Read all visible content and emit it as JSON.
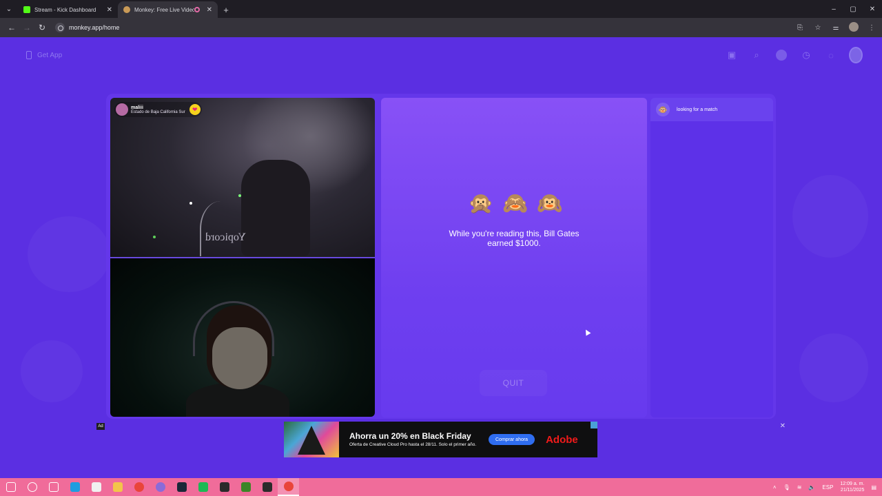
{
  "browser": {
    "tabs": [
      {
        "title": "Stream - Kick Dashboard",
        "favicon_color": "#53fc18",
        "active": false
      },
      {
        "title": "Monkey: Free Live Video Ch",
        "favicon_color": "#c99a57",
        "active": true
      }
    ],
    "new_tab": "+",
    "address": "monkey.app/home",
    "window_controls": {
      "minimize": "–",
      "maximize": "▢",
      "close": "✕"
    }
  },
  "header": {
    "get_app_label": "Get App"
  },
  "remote_video": {
    "user_name": "maliii",
    "user_location": "Estado de Baja California Sur",
    "heart": "❤",
    "mirrored_text": "Yopicord"
  },
  "center": {
    "monkeys": [
      "🙊",
      "🙈",
      "🙉"
    ],
    "message": "While you're reading this, Bill Gates earned $1000.",
    "quit_label": "QUIT"
  },
  "side": {
    "match_icon": "🐵",
    "match_text": "looking for a match"
  },
  "ad": {
    "tag": "Ad",
    "close": "✕",
    "headline": "Ahorra un 20% en Black Friday",
    "subtext": "Oferta de Creative Cloud Pro hasta el 28/11. Solo el primer año.",
    "cta": "Comprar ahora",
    "brand": "Adobe"
  },
  "taskbar": {
    "icons": [
      "windows-start-icon",
      "search-icon",
      "task-view-icon",
      "edge-icon",
      "store-icon",
      "file-explorer-icon",
      "chrome-icon",
      "chrome-profile-icon",
      "steam-icon",
      "spotify-icon",
      "obs-icon",
      "minecraft-icon",
      "epic-games-icon",
      "chrome-active-icon"
    ],
    "colors": [
      "#ffffff",
      "#ffffff",
      "#ffffff",
      "#1f9de0",
      "#f0f0f0",
      "#f3c44a",
      "#e9453a",
      "#8b6bd9",
      "#1b2838",
      "#1db954",
      "#2a2a2a",
      "#3c8527",
      "#2b2b2b",
      "#e9453a"
    ],
    "tray_lang": "ESP",
    "time": "12:09 a. m.",
    "date": "21/11/2025"
  },
  "colors": {
    "page_bg": "#5b2fe2",
    "panel": "#8851f6",
    "taskbar": "#f06c9a"
  }
}
